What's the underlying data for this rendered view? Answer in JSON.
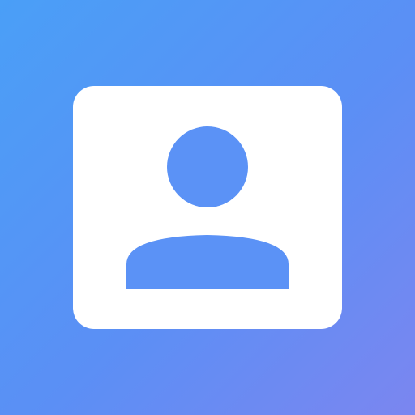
{
  "icon": {
    "name": "contact-card-icon",
    "colors": {
      "gradient_start": "#4a9ff7",
      "gradient_end": "#7b86f0",
      "card": "#ffffff",
      "figure": "#5b92f6"
    }
  }
}
